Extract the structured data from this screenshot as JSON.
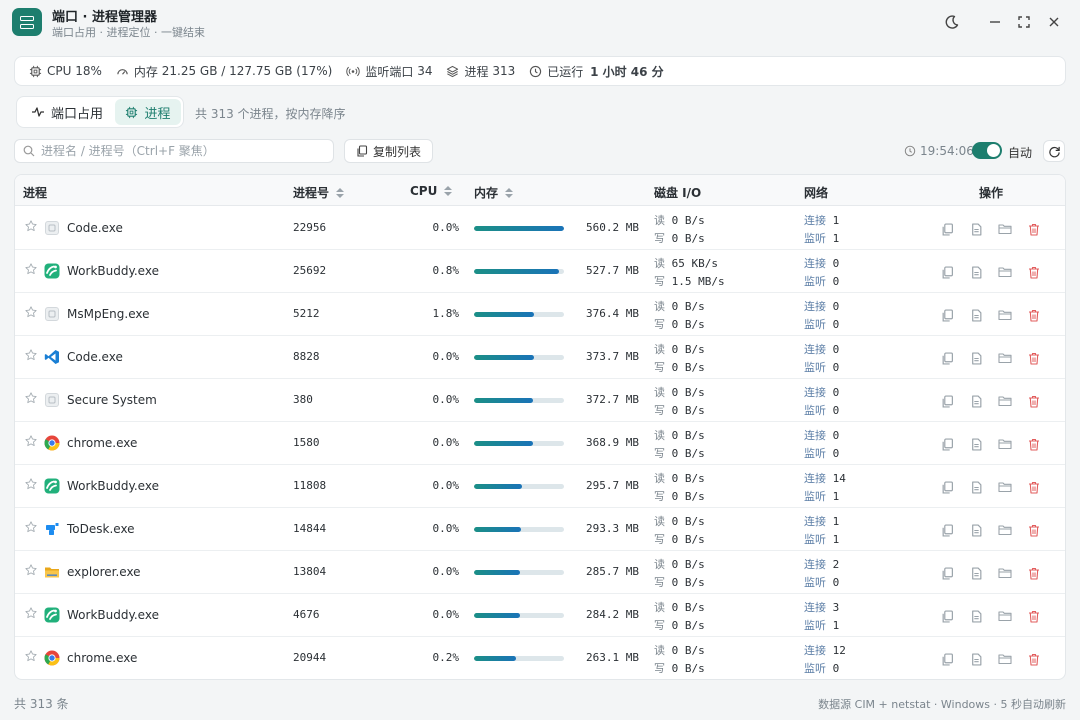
{
  "app": {
    "title": "端口 · 进程管理器",
    "subtitle": "端口占用 · 进程定位 · 一键结束"
  },
  "stats": {
    "cpu_label": "CPU",
    "cpu_value": "18%",
    "mem_label": "内存",
    "mem_value": "21.25 GB / 127.75 GB",
    "mem_percent": "(17%)",
    "ports_label": "监听端口",
    "ports_value": "34",
    "procs_label": "进程",
    "procs_value": "313",
    "uptime_label": "已运行",
    "uptime_value": "1 小时 46 分"
  },
  "tabs": [
    {
      "label": "端口占用",
      "active": false
    },
    {
      "label": "进程",
      "active": true
    }
  ],
  "tab_hint": "共 313 个进程，按内存降序",
  "toolbar": {
    "search_placeholder": "进程名 / 进程号（Ctrl+F 聚焦）",
    "search_value": "",
    "copy_label": "复制列表",
    "time": "19:54:06",
    "auto_label": "自动",
    "auto_enabled": true
  },
  "table": {
    "headers": {
      "name": "进程",
      "pid": "进程号",
      "cpu": "CPU",
      "mem": "内存",
      "disk": "磁盘 I/O",
      "net": "网络",
      "actions": "操作"
    },
    "labels": {
      "read": "读",
      "write": "写",
      "conn": "连接",
      "listen": "监听"
    },
    "rows": [
      {
        "name": "Code.exe",
        "icon": "generic",
        "pid": "22956",
        "cpu": "0.0%",
        "mem_fraction": 1.0,
        "mem": "560.2 MB",
        "read": "0 B/s",
        "write": "0 B/s",
        "conn": "1",
        "listen": "1"
      },
      {
        "name": "WorkBuddy.exe",
        "icon": "workbuddy",
        "pid": "25692",
        "cpu": "0.8%",
        "mem_fraction": 0.94,
        "mem": "527.7 MB",
        "read": "65 KB/s",
        "write": "1.5 MB/s",
        "conn": "0",
        "listen": "0"
      },
      {
        "name": "MsMpEng.exe",
        "icon": "generic",
        "pid": "5212",
        "cpu": "1.8%",
        "mem_fraction": 0.67,
        "mem": "376.4 MB",
        "read": "0 B/s",
        "write": "0 B/s",
        "conn": "0",
        "listen": "0"
      },
      {
        "name": "Code.exe",
        "icon": "vscode",
        "pid": "8828",
        "cpu": "0.0%",
        "mem_fraction": 0.67,
        "mem": "373.7 MB",
        "read": "0 B/s",
        "write": "0 B/s",
        "conn": "0",
        "listen": "0"
      },
      {
        "name": "Secure System",
        "icon": "generic",
        "pid": "380",
        "cpu": "0.0%",
        "mem_fraction": 0.66,
        "mem": "372.7 MB",
        "read": "0 B/s",
        "write": "0 B/s",
        "conn": "0",
        "listen": "0"
      },
      {
        "name": "chrome.exe",
        "icon": "chrome",
        "pid": "1580",
        "cpu": "0.0%",
        "mem_fraction": 0.66,
        "mem": "368.9 MB",
        "read": "0 B/s",
        "write": "0 B/s",
        "conn": "0",
        "listen": "0"
      },
      {
        "name": "WorkBuddy.exe",
        "icon": "workbuddy",
        "pid": "11808",
        "cpu": "0.0%",
        "mem_fraction": 0.53,
        "mem": "295.7 MB",
        "read": "0 B/s",
        "write": "0 B/s",
        "conn": "14",
        "listen": "1"
      },
      {
        "name": "ToDesk.exe",
        "icon": "todesk",
        "pid": "14844",
        "cpu": "0.0%",
        "mem_fraction": 0.52,
        "mem": "293.3 MB",
        "read": "0 B/s",
        "write": "0 B/s",
        "conn": "1",
        "listen": "1"
      },
      {
        "name": "explorer.exe",
        "icon": "folder",
        "pid": "13804",
        "cpu": "0.0%",
        "mem_fraction": 0.51,
        "mem": "285.7 MB",
        "read": "0 B/s",
        "write": "0 B/s",
        "conn": "2",
        "listen": "0"
      },
      {
        "name": "WorkBuddy.exe",
        "icon": "workbuddy",
        "pid": "4676",
        "cpu": "0.0%",
        "mem_fraction": 0.51,
        "mem": "284.2 MB",
        "read": "0 B/s",
        "write": "0 B/s",
        "conn": "3",
        "listen": "1"
      },
      {
        "name": "chrome.exe",
        "icon": "chrome",
        "pid": "20944",
        "cpu": "0.2%",
        "mem_fraction": 0.47,
        "mem": "263.1 MB",
        "read": "0 B/s",
        "write": "0 B/s",
        "conn": "12",
        "listen": "0"
      }
    ]
  },
  "footer": {
    "count": "共 313 条",
    "source": "数据源 CIM + netstat · Windows · 5 秒自动刷新"
  },
  "colors": {
    "accent": "#1d7e6e",
    "delete": "#e25c5c"
  }
}
